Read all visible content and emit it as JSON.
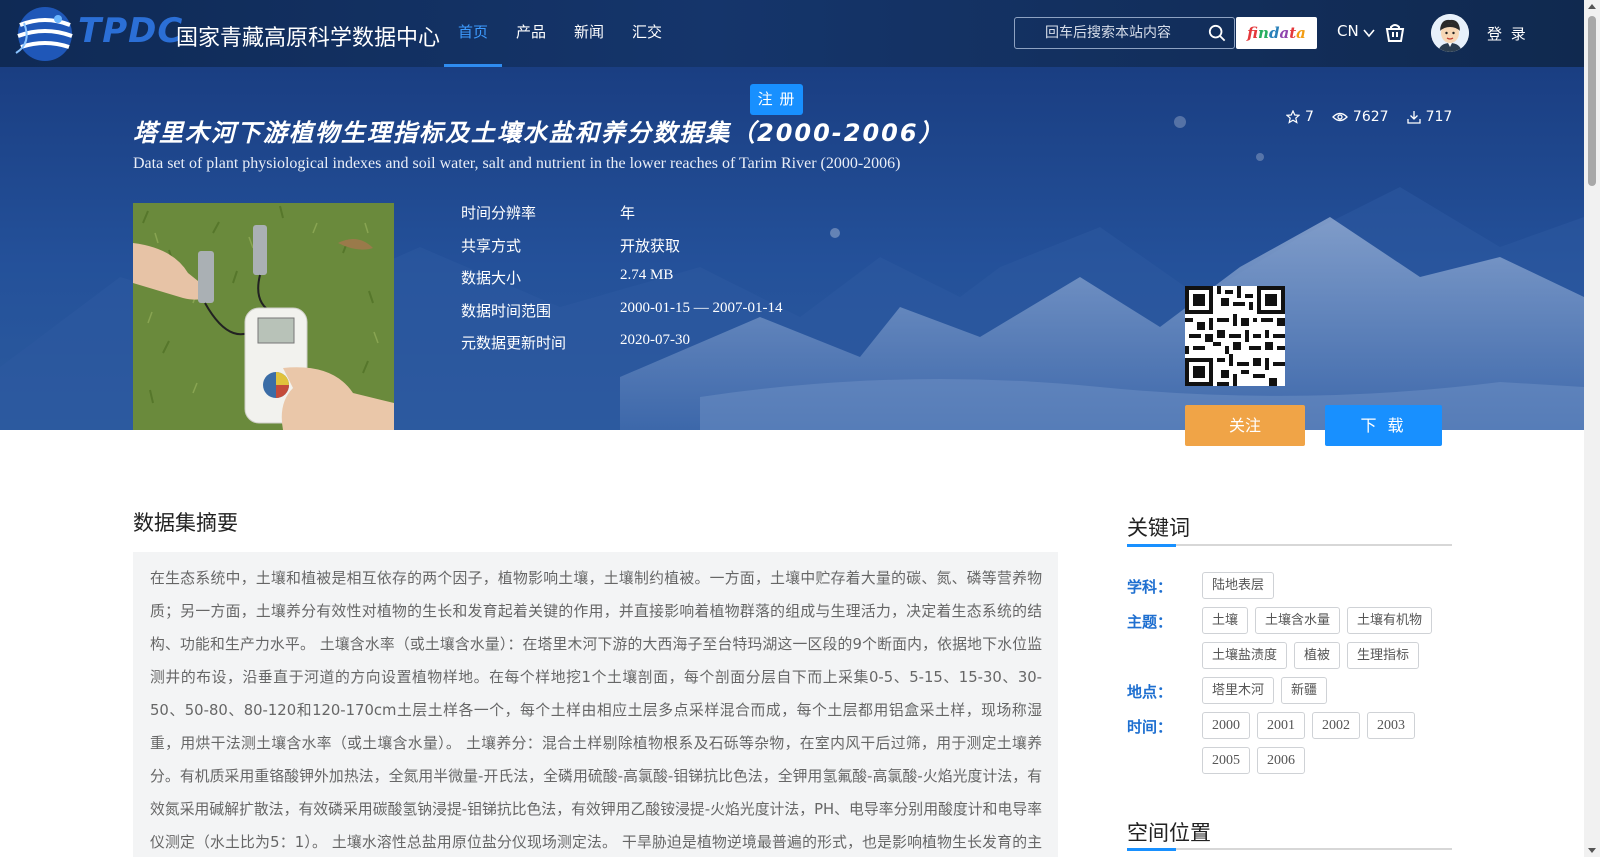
{
  "header": {
    "logo_text": "TPDC",
    "site_name": "国家青藏高原科学数据中心",
    "nav": [
      {
        "label": "首页",
        "active": true
      },
      {
        "label": "产品",
        "active": false
      },
      {
        "label": "新闻",
        "active": false
      },
      {
        "label": "汇交",
        "active": false
      }
    ],
    "search_placeholder": "回车后搜索本站内容",
    "findata_logo": "findata",
    "language": "CN",
    "login_label": "登 录"
  },
  "hero": {
    "register_label": "注 册",
    "title_cn": "塔里木河下游植物生理指标及土壤水盐和养分数据集（2000-2006）",
    "title_en": "Data set of plant physiological indexes and soil water, salt and nutrient in the lower reaches of Tarim River (2000-2006)",
    "stats": {
      "stars": "7",
      "views": "7627",
      "downloads": "717"
    },
    "meta": [
      {
        "label": "时间分辨率",
        "value": "年"
      },
      {
        "label": "共享方式",
        "value": "开放获取"
      },
      {
        "label": "数据大小",
        "value": "2.74 MB"
      },
      {
        "label": "数据时间范围",
        "value": "2000-01-15 — 2007-01-14"
      },
      {
        "label": "元数据更新时间",
        "value": "2020-07-30"
      }
    ],
    "follow_label": "关注",
    "download_label": "下 载"
  },
  "abstract": {
    "title": "数据集摘要",
    "text": "在生态系统中，土壤和植被是相互依存的两个因子，植物影响土壤，土壤制约植被。一方面，土壤中贮存着大量的碳、氮、磷等营养物质；另一方面，土壤养分有效性对植物的生长和发育起着关键的作用，并直接影响着植物群落的组成与生理活力，决定着生态系统的结构、功能和生产力水平。 土壤含水率（或土壤含水量）：在塔里木河下游的大西海子至台特玛湖这一区段的9个断面内，依据地下水位监测井的布设，沿垂直于河道的方向设置植物样地。在每个样地挖1个土壤剖面，每个剖面分层自下而上采集0-5、5-15、15-30、30-50、50-80、80-120和120-170cm土层土样各一个，每个土样由相应土层多点采样混合而成，每个土层都用铝盒采土样，现场称湿重，用烘干法测土壤含水率（或土壤含水量）。 土壤养分：混合土样剔除植物根系及石砾等杂物，在室内风干后过筛，用于测定土壤养分。有机质采用重铬酸钾外加热法，全氮用半微量-开氏法，全磷用硫酸-高氯酸-钼锑抗比色法，全钾用氢氟酸-高氯酸-火焰光度计法，有效氮采用碱解扩散法，有效磷采用碳酸氢钠浸提-钼锑抗比色法，有效钾用乙酸铵浸提-火焰光度计法，PH、电导率分别用酸度计和电导率仪测定（水土比为5：1）。 土壤水溶性总盐用原位盐分仪现场测定法。 干旱胁迫是植物逆境最普遍的形式，也是影响植物生长发育的主要因"
  },
  "keywords": {
    "title": "关键词",
    "groups": [
      {
        "label": "学科：",
        "tags": [
          "陆地表层"
        ]
      },
      {
        "label": "主题：",
        "tags": [
          "土壤",
          "土壤含水量",
          "土壤有机物",
          "土壤盐渍度",
          "植被",
          "生理指标"
        ]
      },
      {
        "label": "地点：",
        "tags": [
          "塔里木河",
          "新疆"
        ]
      },
      {
        "label": "时间：",
        "tags": [
          "2000",
          "2001",
          "2002",
          "2003",
          "2005",
          "2006"
        ]
      }
    ]
  },
  "location": {
    "title": "空间位置"
  },
  "colors": {
    "accent": "#1890ff",
    "follow": "#f0a447",
    "header_bg": "#15356b",
    "keyword_label": "#1e6fd0"
  }
}
